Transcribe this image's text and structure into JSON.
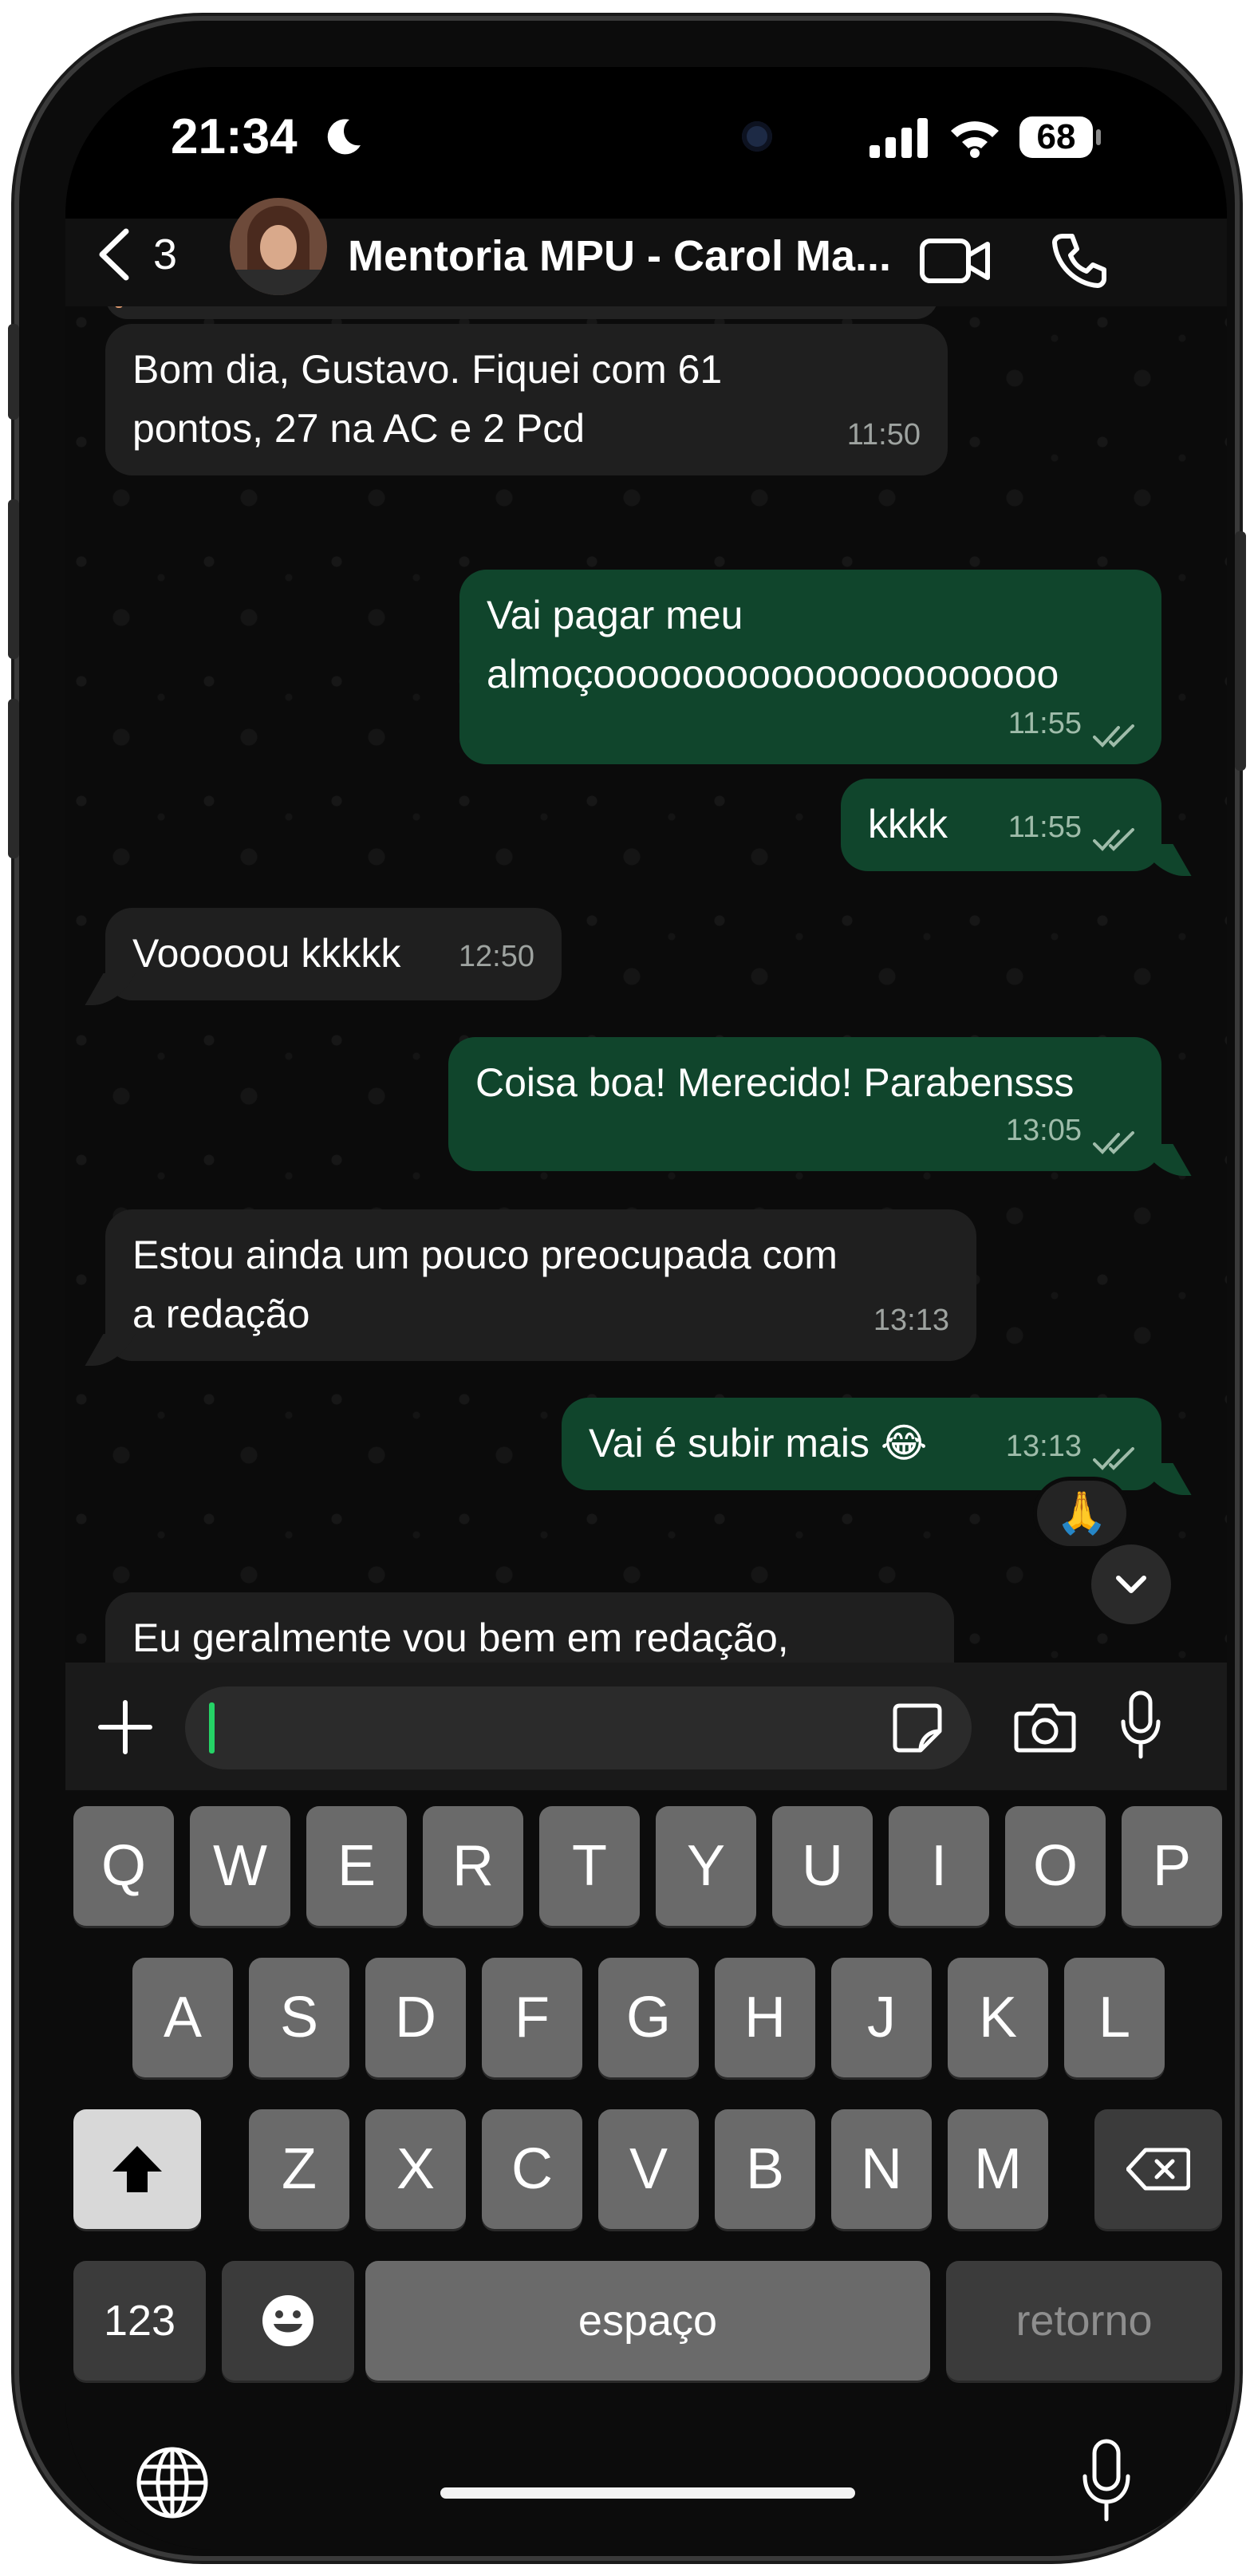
{
  "status_bar": {
    "time": "21:34",
    "battery": "68"
  },
  "header": {
    "back_count": "3",
    "contact_name": "Mentoria MPU - Carol Ma..."
  },
  "messages": [
    {
      "text": "Bom dia, Gustavo. Fiquei com 61\npontos, 27 na AC e 2 Pcd",
      "time": "11:50",
      "dir": "in"
    },
    {
      "text": "Vai pagar meu\nalmoçooooooooooooooooooooo",
      "time": "11:55",
      "dir": "out"
    },
    {
      "text": "kkkk",
      "time": "11:55",
      "dir": "out"
    },
    {
      "text": "Vooooou kkkkk",
      "time": "12:50",
      "dir": "in"
    },
    {
      "text": "Coisa boa! Merecido! Parabensss",
      "time": "13:05",
      "dir": "out"
    },
    {
      "text": "Estou ainda um pouco preocupada com\na redação",
      "time": "13:13",
      "dir": "in"
    },
    {
      "text": "Vai é subir mais 😂",
      "time": "13:13",
      "dir": "out"
    },
    {
      "text": "Eu geralmente vou bem em redação,\nmas dessa vez eu tive que correr pra",
      "time": "",
      "dir": "in"
    }
  ],
  "reaction": "🙏",
  "keyboard": {
    "row1": [
      "Q",
      "W",
      "E",
      "R",
      "T",
      "Y",
      "U",
      "I",
      "O",
      "P"
    ],
    "row2": [
      "A",
      "S",
      "D",
      "F",
      "G",
      "H",
      "J",
      "K",
      "L"
    ],
    "row3": [
      "Z",
      "X",
      "C",
      "V",
      "B",
      "N",
      "M"
    ],
    "numbers_key": "123",
    "space_key": "espaço",
    "return_key": "retorno"
  },
  "colors": {
    "outgoing_bubble": "#10452c",
    "incoming_bubble": "#1f1f1f",
    "cursor": "#25d366"
  },
  "icons": [
    "back-chevron-icon",
    "video-call-icon",
    "phone-icon",
    "plus-icon",
    "sticker-icon",
    "camera-icon",
    "mic-icon",
    "scroll-down-icon",
    "shift-icon",
    "backspace-icon",
    "emoji-icon",
    "globe-icon",
    "dictation-icon"
  ]
}
